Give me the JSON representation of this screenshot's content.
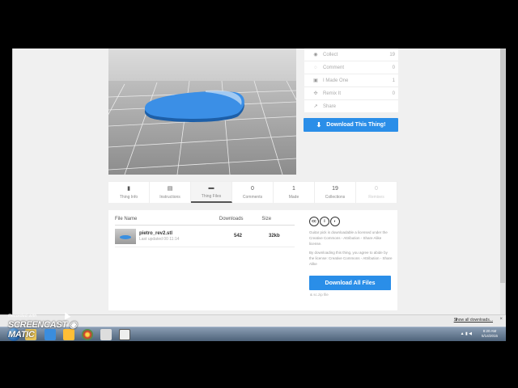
{
  "actions": [
    {
      "icon": "eye-icon",
      "glyph": "◉",
      "label": "Collect",
      "count": "19"
    },
    {
      "icon": "comment-icon",
      "glyph": "◌",
      "label": "Comment",
      "count": "0"
    },
    {
      "icon": "camera-icon",
      "glyph": "▣",
      "label": "I Made One",
      "count": "1"
    },
    {
      "icon": "remix-icon",
      "glyph": "✣",
      "label": "Remix It",
      "count": "0"
    },
    {
      "icon": "share-icon",
      "glyph": "↗",
      "label": "Share",
      "count": ""
    }
  ],
  "download_thing": {
    "label": "Download This Thing!",
    "glyph": "⬇"
  },
  "tabs": [
    {
      "top": "▮",
      "label": "Thing Info"
    },
    {
      "top": "▤",
      "label": "Instructions"
    },
    {
      "top": "▬",
      "label": "Thing Files"
    },
    {
      "top": "0",
      "label": "Comments"
    },
    {
      "top": "1",
      "label": "Made"
    },
    {
      "top": "19",
      "label": "Collections"
    },
    {
      "top": "0",
      "label": "Remixes"
    }
  ],
  "files": {
    "headers": {
      "name": "File Name",
      "downloads": "Downloads",
      "size": "Size"
    },
    "row": {
      "name": "pietro_rev2.stl",
      "updated": "Last updated 00 11:14",
      "downloads": "542",
      "size": "32kb"
    }
  },
  "license": {
    "cc_glyphs": [
      "cc",
      "i",
      "◐"
    ],
    "text1": "Guitar pick is downloadable a licensed under the Creative Commons - Attribution - Share Alike license.",
    "text2": "By downloading this thing, you agree to abide by the license: Creative Commons - Attribution - Share Alike",
    "download_all": "Download All Files",
    "zip_size": "& sc.zip file"
  },
  "download_bar": {
    "show_all": "Show all downloads...",
    "close": "×",
    "icon_glyph": "⬇"
  },
  "taskbar": {
    "time": "8:20 AM",
    "date": "5/14/2015",
    "tray": "▲ ▮ ◀"
  },
  "watermark": {
    "recorded": "Recorded with",
    "logo": "SCREENCAST ◉ MATIC"
  },
  "colors": {
    "accent": "#2a8ee8"
  }
}
